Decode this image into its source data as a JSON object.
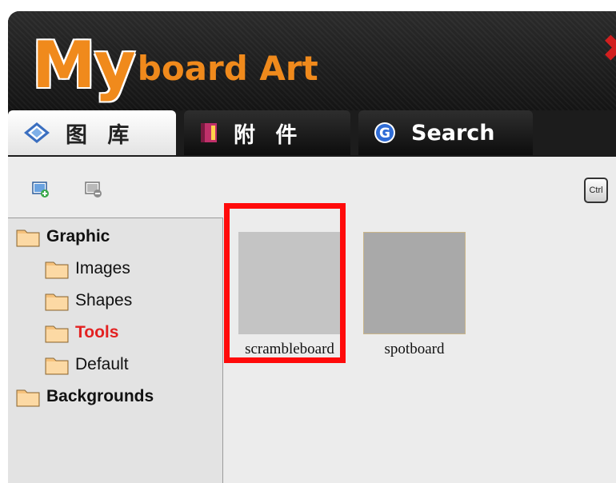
{
  "app": {
    "logo_big": "My",
    "logo_rest": "board Art",
    "close_glyph": "✖"
  },
  "tabs": [
    {
      "label": "图 库",
      "icon": "diamond-gallery-icon",
      "active": true
    },
    {
      "label": "附 件",
      "icon": "book-attachment-icon",
      "active": false
    },
    {
      "label": "Search",
      "icon": "google-g-icon",
      "active": false
    }
  ],
  "toolbar": {
    "add_icon": "add-image-icon",
    "remove_icon": "remove-image-icon",
    "ctrl_label": "Ctrl"
  },
  "tree": {
    "items": [
      {
        "label": "Graphic",
        "level": 0
      },
      {
        "label": "Images",
        "level": 1
      },
      {
        "label": "Shapes",
        "level": 1
      },
      {
        "label": "Tools",
        "level": 1,
        "selected": true
      },
      {
        "label": "Default",
        "level": 1
      },
      {
        "label": "Backgrounds",
        "level": 0
      }
    ]
  },
  "thumbnails": [
    {
      "caption": "scrambleboard",
      "highlighted": true
    },
    {
      "caption": "spotboard",
      "highlighted": false
    }
  ],
  "colors": {
    "accent_orange": "#f08a1c",
    "selected_red": "#e32222",
    "highlight_red": "#ff0a0a"
  }
}
